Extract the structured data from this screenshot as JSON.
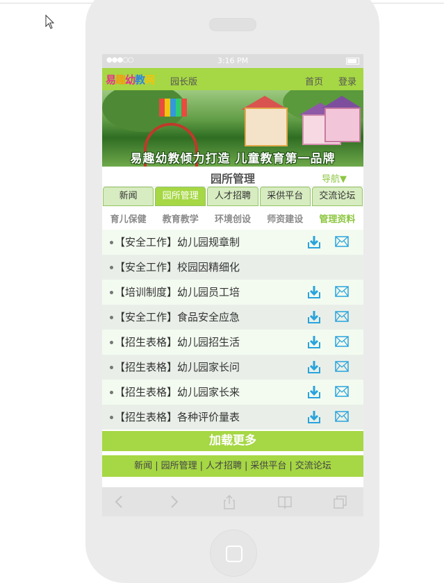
{
  "status_bar": {
    "signal": "●●●○○",
    "time": "3:16 PM"
  },
  "header": {
    "logo_chars": [
      "易",
      "趣",
      "幼",
      "教",
      "网"
    ],
    "edition": "园长版",
    "home": "首页",
    "login": "登录"
  },
  "banner": {
    "text": "易趣幼教倾力打造 儿童教育第一品牌"
  },
  "title_bar": {
    "title": "园所管理",
    "nav_toggle": "导航▼"
  },
  "tabs": [
    {
      "label": "新闻",
      "active": false
    },
    {
      "label": "园所管理",
      "active": true
    },
    {
      "label": "人才招聘",
      "active": false
    },
    {
      "label": "采供平台",
      "active": false
    },
    {
      "label": "交流论坛",
      "active": false
    }
  ],
  "subtabs": [
    {
      "label": "育儿保健",
      "active": false
    },
    {
      "label": "教育教学",
      "active": false
    },
    {
      "label": "环境创设",
      "active": false
    },
    {
      "label": "师资建设",
      "active": false
    },
    {
      "label": "管理资料",
      "active": true
    }
  ],
  "items": [
    {
      "text": "【安全工作】幼儿园规章制",
      "download": true,
      "mail": true
    },
    {
      "text": "【安全工作】校园因精细化",
      "download": false,
      "mail": false
    },
    {
      "text": "【培训制度】幼儿园员工培",
      "download": true,
      "mail": true
    },
    {
      "text": "【安全工作】食品安全应急",
      "download": true,
      "mail": true
    },
    {
      "text": "【招生表格】幼儿园招生活",
      "download": true,
      "mail": true
    },
    {
      "text": "【招生表格】幼儿园家长问",
      "download": true,
      "mail": true
    },
    {
      "text": "【招生表格】幼儿园家长来",
      "download": true,
      "mail": true
    },
    {
      "text": "【招生表格】各种评价量表",
      "download": true,
      "mail": true
    }
  ],
  "load_more": "加载更多",
  "footer_nav": [
    "新闻",
    "园所管理",
    "人才招聘",
    "采供平台",
    "交流论坛"
  ],
  "footer_sep": "|",
  "colors": {
    "accent_green": "#a6d744",
    "icon_blue": "#29a3dd"
  },
  "toolbar_icons": [
    "back-icon",
    "forward-icon",
    "share-icon",
    "bookmarks-icon",
    "tabs-icon"
  ]
}
